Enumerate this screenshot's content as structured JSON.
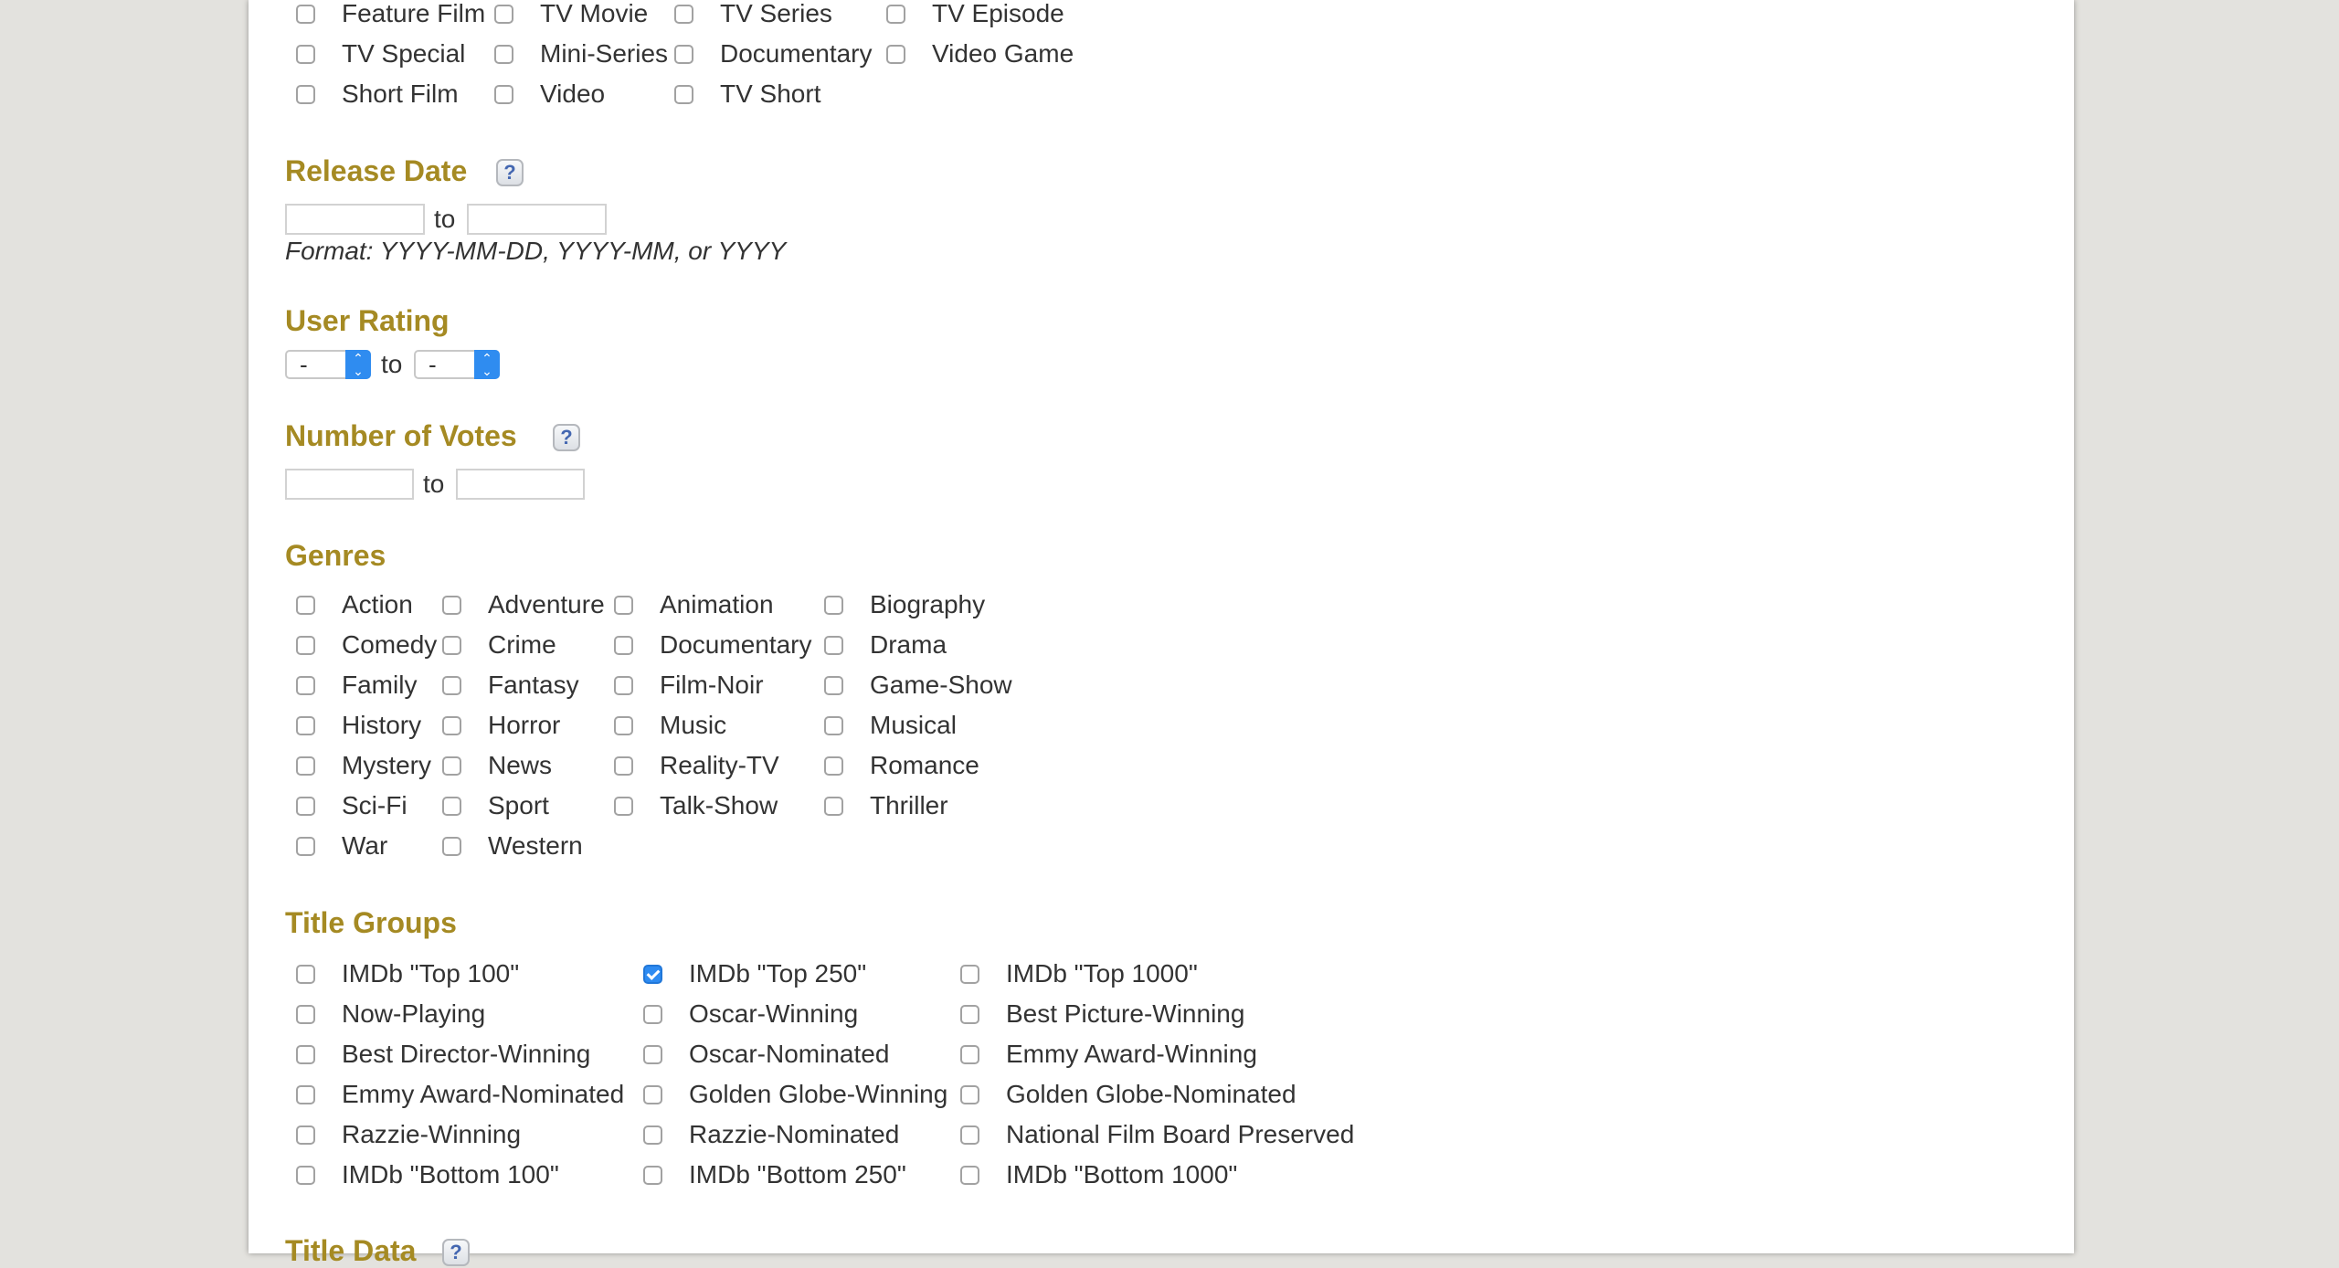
{
  "title_type": {
    "items": [
      {
        "label": "Feature Film",
        "checked": false
      },
      {
        "label": "TV Movie",
        "checked": false
      },
      {
        "label": "TV Series",
        "checked": false
      },
      {
        "label": "TV Episode",
        "checked": false
      },
      {
        "label": "TV Special",
        "checked": false
      },
      {
        "label": "Mini-Series",
        "checked": false
      },
      {
        "label": "Documentary",
        "checked": false
      },
      {
        "label": "Video Game",
        "checked": false
      },
      {
        "label": "Short Film",
        "checked": false
      },
      {
        "label": "Video",
        "checked": false
      },
      {
        "label": "TV Short",
        "checked": false
      }
    ]
  },
  "release_date": {
    "title": "Release Date",
    "help": "?",
    "to": "to",
    "from_value": "",
    "to_value": "",
    "format": "Format: YYYY-MM-DD, YYYY-MM, or YYYY"
  },
  "user_rating": {
    "title": "User Rating",
    "from_selected": "-",
    "to_selected": "-",
    "to": "to"
  },
  "num_votes": {
    "title": "Number of Votes",
    "help": "?",
    "to": "to",
    "from_value": "",
    "to_value": ""
  },
  "genres": {
    "title": "Genres",
    "items": [
      {
        "label": "Action"
      },
      {
        "label": "Adventure"
      },
      {
        "label": "Animation"
      },
      {
        "label": "Biography"
      },
      {
        "label": "Comedy"
      },
      {
        "label": "Crime"
      },
      {
        "label": "Documentary"
      },
      {
        "label": "Drama"
      },
      {
        "label": "Family"
      },
      {
        "label": "Fantasy"
      },
      {
        "label": "Film-Noir"
      },
      {
        "label": "Game-Show"
      },
      {
        "label": "History"
      },
      {
        "label": "Horror"
      },
      {
        "label": "Music"
      },
      {
        "label": "Musical"
      },
      {
        "label": "Mystery"
      },
      {
        "label": "News"
      },
      {
        "label": "Reality-TV"
      },
      {
        "label": "Romance"
      },
      {
        "label": "Sci-Fi"
      },
      {
        "label": "Sport"
      },
      {
        "label": "Talk-Show"
      },
      {
        "label": "Thriller"
      },
      {
        "label": "War"
      },
      {
        "label": "Western"
      }
    ]
  },
  "title_groups": {
    "title": "Title Groups",
    "items": [
      {
        "label": "IMDb \"Top 100\"",
        "checked": false
      },
      {
        "label": "IMDb \"Top 250\"",
        "checked": true
      },
      {
        "label": "IMDb \"Top 1000\"",
        "checked": false
      },
      {
        "label": "Now-Playing",
        "checked": false
      },
      {
        "label": "Oscar-Winning",
        "checked": false
      },
      {
        "label": "Best Picture-Winning",
        "checked": false
      },
      {
        "label": "Best Director-Winning",
        "checked": false
      },
      {
        "label": "Oscar-Nominated",
        "checked": false
      },
      {
        "label": "Emmy Award-Winning",
        "checked": false
      },
      {
        "label": "Emmy Award-Nominated",
        "checked": false
      },
      {
        "label": "Golden Globe-Winning",
        "checked": false
      },
      {
        "label": "Golden Globe-Nominated",
        "checked": false
      },
      {
        "label": "Razzie-Winning",
        "checked": false
      },
      {
        "label": "Razzie-Nominated",
        "checked": false
      },
      {
        "label": "National Film Board Preserved",
        "checked": false
      },
      {
        "label": "IMDb \"Bottom 100\"",
        "checked": false
      },
      {
        "label": "IMDb \"Bottom 250\"",
        "checked": false
      },
      {
        "label": "IMDb \"Bottom 1000\"",
        "checked": false
      }
    ]
  },
  "title_data": {
    "title": "Title Data",
    "help": "?"
  },
  "colors": {
    "section_title": "#a58a23",
    "checkbox_checked": "#2d8bf2",
    "help_icon_text": "#4467b1",
    "page_background": "#e3e2de"
  }
}
